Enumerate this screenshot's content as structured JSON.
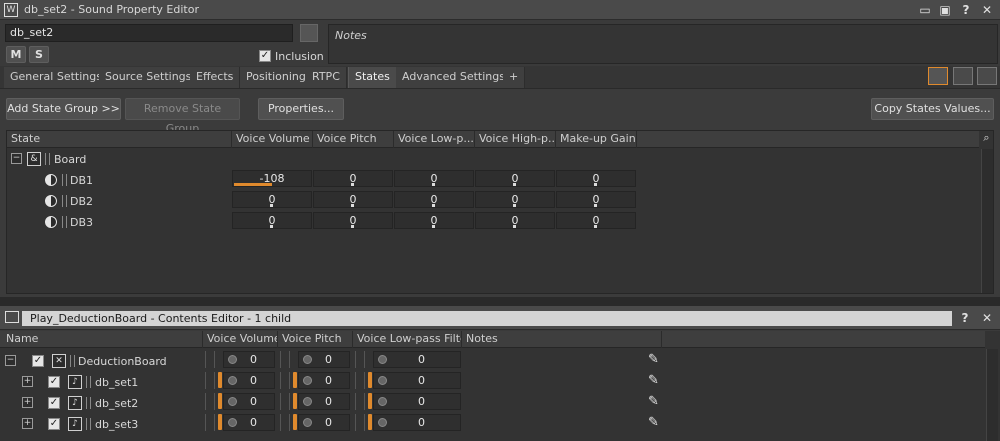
{
  "window": {
    "title": "db_set2 - Sound Property Editor"
  },
  "name_field": {
    "value": "db_set2"
  },
  "mute_button": "M",
  "solo_button": "S",
  "inclusion": {
    "label": "Inclusion",
    "checked": true
  },
  "notes": {
    "placeholder": "Notes"
  },
  "tabs": [
    {
      "label": "General Settings"
    },
    {
      "label": "Source Settings"
    },
    {
      "label": "Effects"
    },
    {
      "label": "Positioning"
    },
    {
      "label": "RTPC"
    },
    {
      "label": "States",
      "active": true
    },
    {
      "label": "Advanced Settings"
    },
    {
      "label": "+"
    }
  ],
  "toolbar": {
    "add_state_group": "Add State Group >>",
    "remove_state_group": "Remove State Group",
    "properties": "Properties...",
    "copy_states": "Copy States Values..."
  },
  "states_grid": {
    "columns": [
      "State",
      "Voice Volume",
      "Voice Pitch",
      "Voice Low-p...",
      "Voice High-p...",
      "Make-up Gain"
    ],
    "group": "Board",
    "rows": [
      {
        "name": "DB1",
        "values": [
          "-108",
          "0",
          "0",
          "0",
          "0"
        ],
        "volume_level": 0.5
      },
      {
        "name": "DB2",
        "values": [
          "0",
          "0",
          "0",
          "0",
          "0"
        ]
      },
      {
        "name": "DB3",
        "values": [
          "0",
          "0",
          "0",
          "0",
          "0"
        ]
      }
    ]
  },
  "contents_editor": {
    "title": "Play_DeductionBoard - Contents Editor - 1 child",
    "columns": [
      "Name",
      "Voice Volume",
      "Voice Pitch",
      "Voice Low-pass Filter",
      "Notes"
    ],
    "rows": [
      {
        "name": "DeductionBoard",
        "volume": "0",
        "pitch": "0",
        "lpf": "0",
        "expand": "⊟"
      },
      {
        "name": "db_set1",
        "volume": "0",
        "pitch": "0",
        "lpf": "0",
        "expand": "⊞"
      },
      {
        "name": "db_set2",
        "volume": "0",
        "pitch": "0",
        "lpf": "0",
        "expand": "⊞"
      },
      {
        "name": "db_set3",
        "volume": "0",
        "pitch": "0",
        "lpf": "0",
        "expand": "⊞"
      }
    ]
  },
  "colors": {
    "accent": "#e08a2d",
    "background": "#3a3a3a"
  },
  "icons": [
    "folder-icon",
    "save-icon",
    "help-icon",
    "close-icon",
    "pencil-icon",
    "search-icon"
  ]
}
